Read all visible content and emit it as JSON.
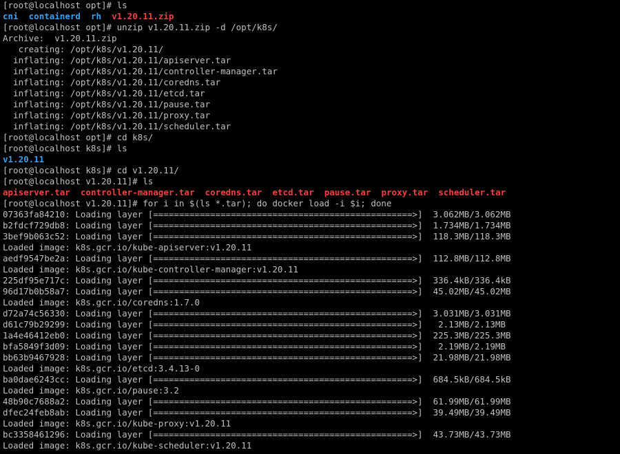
{
  "colors": {
    "background": "#000000",
    "text": "#c0c0c0",
    "directory": "#3a9ff0",
    "archive": "#f04040"
  },
  "lines": [
    {
      "type": "text",
      "text": "[root@localhost opt]# ls"
    },
    {
      "type": "list",
      "items": [
        {
          "text": "cni",
          "style": "blue"
        },
        {
          "text": "containerd",
          "style": "blue"
        },
        {
          "text": "rh",
          "style": "blue"
        },
        {
          "text": "v1.20.11.zip",
          "style": "red"
        }
      ],
      "gap": "  "
    },
    {
      "type": "text",
      "text": "[root@localhost opt]# unzip v1.20.11.zip -d /opt/k8s/"
    },
    {
      "type": "text",
      "text": "Archive:  v1.20.11.zip"
    },
    {
      "type": "text",
      "text": "   creating: /opt/k8s/v1.20.11/"
    },
    {
      "type": "text",
      "text": "  inflating: /opt/k8s/v1.20.11/apiserver.tar"
    },
    {
      "type": "text",
      "text": "  inflating: /opt/k8s/v1.20.11/controller-manager.tar"
    },
    {
      "type": "text",
      "text": "  inflating: /opt/k8s/v1.20.11/coredns.tar"
    },
    {
      "type": "text",
      "text": "  inflating: /opt/k8s/v1.20.11/etcd.tar"
    },
    {
      "type": "text",
      "text": "  inflating: /opt/k8s/v1.20.11/pause.tar"
    },
    {
      "type": "text",
      "text": "  inflating: /opt/k8s/v1.20.11/proxy.tar"
    },
    {
      "type": "text",
      "text": "  inflating: /opt/k8s/v1.20.11/scheduler.tar"
    },
    {
      "type": "text",
      "text": "[root@localhost opt]# cd k8s/"
    },
    {
      "type": "text",
      "text": "[root@localhost k8s]# ls"
    },
    {
      "type": "list",
      "items": [
        {
          "text": "v1.20.11",
          "style": "blue"
        }
      ],
      "gap": "  "
    },
    {
      "type": "text",
      "text": "[root@localhost k8s]# cd v1.20.11/"
    },
    {
      "type": "text",
      "text": "[root@localhost v1.20.11]# ls"
    },
    {
      "type": "list",
      "items": [
        {
          "text": "apiserver.tar",
          "style": "red"
        },
        {
          "text": "controller-manager.tar",
          "style": "red"
        },
        {
          "text": "coredns.tar",
          "style": "red"
        },
        {
          "text": "etcd.tar",
          "style": "red"
        },
        {
          "text": "pause.tar",
          "style": "red"
        },
        {
          "text": "proxy.tar",
          "style": "red"
        },
        {
          "text": "scheduler.tar",
          "style": "red"
        }
      ],
      "gap": "  "
    },
    {
      "type": "text",
      "text": "[root@localhost v1.20.11]# for i in $(ls *.tar); do docker load -i $i; done"
    },
    {
      "type": "text",
      "text": "07363fa84210: Loading layer [==================================================>]  3.062MB/3.062MB"
    },
    {
      "type": "text",
      "text": "b2fdcf729db8: Loading layer [==================================================>]  1.734MB/1.734MB"
    },
    {
      "type": "text",
      "text": "3bef9b063c52: Loading layer [==================================================>]  118.3MB/118.3MB"
    },
    {
      "type": "text",
      "text": "Loaded image: k8s.gcr.io/kube-apiserver:v1.20.11"
    },
    {
      "type": "text",
      "text": "aedf9547be2a: Loading layer [==================================================>]  112.8MB/112.8MB"
    },
    {
      "type": "text",
      "text": "Loaded image: k8s.gcr.io/kube-controller-manager:v1.20.11"
    },
    {
      "type": "text",
      "text": "225df95e717c: Loading layer [==================================================>]  336.4kB/336.4kB"
    },
    {
      "type": "text",
      "text": "96d17b0b58a7: Loading layer [==================================================>]  45.02MB/45.02MB"
    },
    {
      "type": "text",
      "text": "Loaded image: k8s.gcr.io/coredns:1.7.0"
    },
    {
      "type": "text",
      "text": "d72a74c56330: Loading layer [==================================================>]  3.031MB/3.031MB"
    },
    {
      "type": "text",
      "text": "d61c79b29299: Loading layer [==================================================>]   2.13MB/2.13MB"
    },
    {
      "type": "text",
      "text": "1a4e46412eb0: Loading layer [==================================================>]  225.3MB/225.3MB"
    },
    {
      "type": "text",
      "text": "bfa5849f3d09: Loading layer [==================================================>]   2.19MB/2.19MB"
    },
    {
      "type": "text",
      "text": "bb63b9467928: Loading layer [==================================================>]  21.98MB/21.98MB"
    },
    {
      "type": "text",
      "text": "Loaded image: k8s.gcr.io/etcd:3.4.13-0"
    },
    {
      "type": "text",
      "text": "ba0dae6243cc: Loading layer [==================================================>]  684.5kB/684.5kB"
    },
    {
      "type": "text",
      "text": "Loaded image: k8s.gcr.io/pause:3.2"
    },
    {
      "type": "text",
      "text": "48b90c7688a2: Loading layer [==================================================>]  61.99MB/61.99MB"
    },
    {
      "type": "text",
      "text": "dfec24feb8ab: Loading layer [==================================================>]  39.49MB/39.49MB"
    },
    {
      "type": "text",
      "text": "Loaded image: k8s.gcr.io/kube-proxy:v1.20.11"
    },
    {
      "type": "text",
      "text": "bc3358461296: Loading layer [==================================================>]  43.73MB/43.73MB"
    },
    {
      "type": "text",
      "text": "Loaded image: k8s.gcr.io/kube-scheduler:v1.20.11"
    }
  ]
}
